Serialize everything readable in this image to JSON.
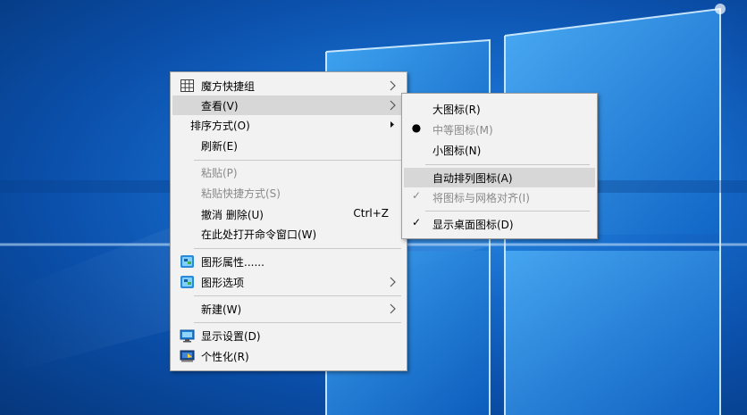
{
  "colors": {
    "desktop_dark": "#06377c",
    "desktop_bright": "#2e8fe6",
    "menu_background": "#f2f2f2",
    "menu_highlight": "#d7d7d7",
    "disabled_text": "#8a8a8a"
  },
  "context_menu": {
    "items": [
      {
        "label": "魔方快捷组",
        "icon": "grid-icon",
        "submenu": true
      },
      {
        "label": "查看(V)",
        "submenu": true,
        "highlighted": true
      },
      {
        "label": "排序方式(O)",
        "submenu": true
      },
      {
        "label": "刷新(E)"
      },
      {
        "label": "粘贴(P)",
        "disabled": true
      },
      {
        "label": "粘贴快捷方式(S)",
        "disabled": true
      },
      {
        "label": "撤消 删除(U)",
        "shortcut": "Ctrl+Z"
      },
      {
        "label": "在此处打开命令窗口(W)"
      },
      {
        "label": "图形属性......",
        "icon": "graphics-icon"
      },
      {
        "label": "图形选项",
        "icon": "graphics-icon",
        "submenu": true
      },
      {
        "label": "新建(W)",
        "submenu": true
      },
      {
        "label": "显示设置(D)",
        "icon": "display-icon"
      },
      {
        "label": "个性化(R)",
        "icon": "personalize-icon"
      }
    ]
  },
  "view_submenu": {
    "items": [
      {
        "label": "大图标(R)"
      },
      {
        "label": "中等图标(M)",
        "disabled": true,
        "mark": "●",
        "mark_name": "bullet-icon"
      },
      {
        "label": "小图标(N)"
      },
      {
        "label": "自动排列图标(A)",
        "highlighted": true
      },
      {
        "label": "将图标与网格对齐(I)",
        "disabled": true,
        "mark": "✓",
        "mark_name": "checkmark-icon"
      },
      {
        "label": "显示桌面图标(D)",
        "mark": "✓",
        "mark_name": "checkmark-icon"
      }
    ]
  }
}
